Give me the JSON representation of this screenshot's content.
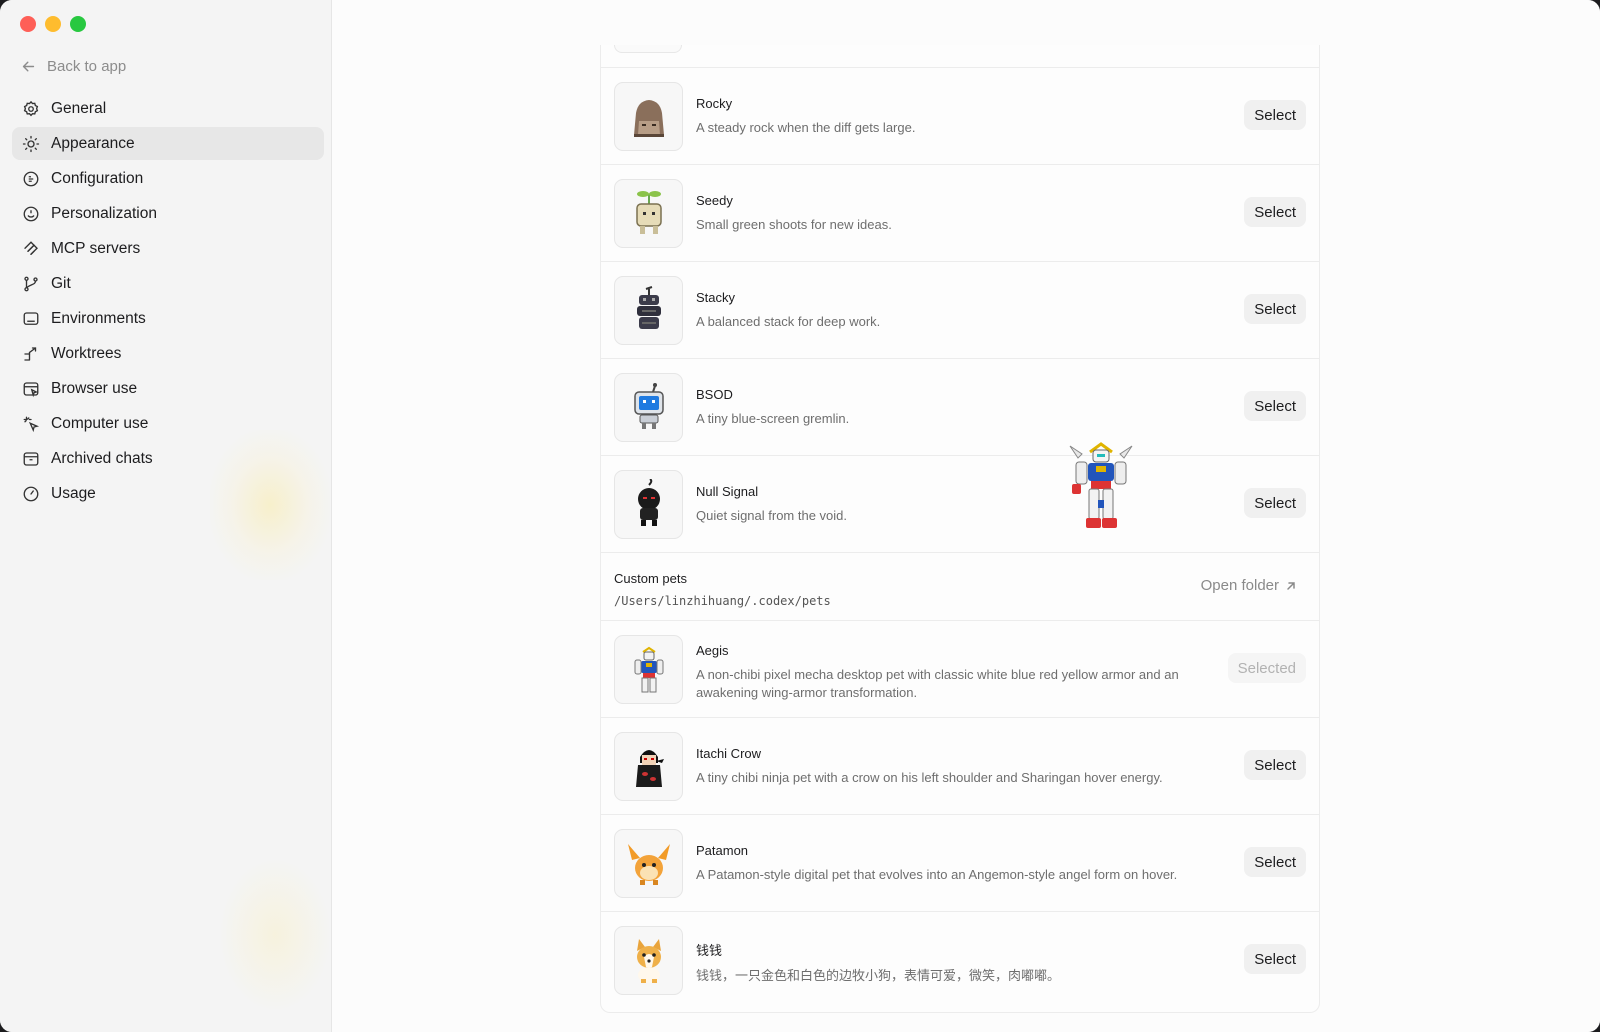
{
  "window": {
    "controls": [
      "close",
      "minimize",
      "maximize"
    ]
  },
  "sidebar": {
    "back_label": "Back to app",
    "items": [
      {
        "label": "General",
        "icon": "gear-icon"
      },
      {
        "label": "Appearance",
        "icon": "sun-icon",
        "active": true
      },
      {
        "label": "Configuration",
        "icon": "config-icon"
      },
      {
        "label": "Personalization",
        "icon": "personalization-icon"
      },
      {
        "label": "MCP servers",
        "icon": "mcp-icon"
      },
      {
        "label": "Git",
        "icon": "git-branch-icon"
      },
      {
        "label": "Environments",
        "icon": "monitor-icon"
      },
      {
        "label": "Worktrees",
        "icon": "worktree-icon"
      },
      {
        "label": "Browser use",
        "icon": "browser-icon"
      },
      {
        "label": "Computer use",
        "icon": "cursor-sparkle-icon"
      },
      {
        "label": "Archived chats",
        "icon": "archive-icon"
      },
      {
        "label": "Usage",
        "icon": "gauge-icon"
      }
    ]
  },
  "pets": [
    {
      "name": "Rocky",
      "description": "A steady rock when the diff gets large.",
      "button": "Select",
      "icon": "rock-pet-icon"
    },
    {
      "name": "Seedy",
      "description": "Small green shoots for new ideas.",
      "button": "Select",
      "icon": "sprout-pet-icon"
    },
    {
      "name": "Stacky",
      "description": "A balanced stack for deep work.",
      "button": "Select",
      "icon": "stack-pet-icon"
    },
    {
      "name": "BSOD",
      "description": "A tiny blue-screen gremlin.",
      "button": "Select",
      "icon": "robot-pet-icon"
    },
    {
      "name": "Null Signal",
      "description": "Quiet signal from the void.",
      "button": "Select",
      "icon": "shadow-pet-icon"
    }
  ],
  "custom_section": {
    "title": "Custom pets",
    "path": "/Users/linzhihuang/.codex/pets",
    "open_folder_label": "Open folder"
  },
  "custom_pets": [
    {
      "name": "Aegis",
      "description": "A non-chibi pixel mecha desktop pet with classic white blue red yellow armor and an awakening wing-armor transformation.",
      "button": "Selected",
      "icon": "mecha-pet-icon"
    },
    {
      "name": "Itachi Crow",
      "description": "A tiny chibi ninja pet with a crow on his left shoulder and Sharingan hover energy.",
      "button": "Select",
      "icon": "ninja-pet-icon"
    },
    {
      "name": "Patamon",
      "description": "A Patamon-style digital pet that evolves into an Angemon-style angel form on hover.",
      "button": "Select",
      "icon": "patamon-pet-icon"
    },
    {
      "name": "钱钱",
      "description": "钱钱，一只金色和白色的边牧小狗，表情可爱，微笑，肉嘟嘟。",
      "button": "Select",
      "icon": "dog-pet-icon"
    }
  ],
  "colors": {
    "accent_selected": "#b2b2b2",
    "button_bg": "#f0f0f0",
    "traffic_close": "#fe5f57",
    "traffic_min": "#febc2e",
    "traffic_max": "#28c840"
  }
}
